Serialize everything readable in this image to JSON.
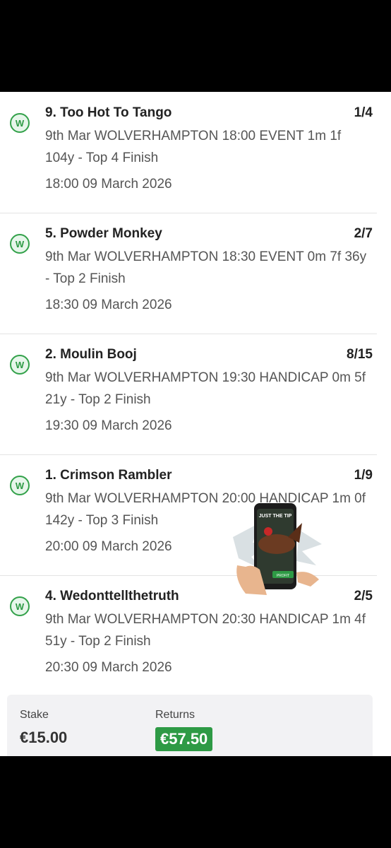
{
  "legs": [
    {
      "badge": "W",
      "selection": "9. Too Hot To Tango",
      "odds": "1/4",
      "description": "9th Mar WOLVERHAMPTON 18:00 EVENT 1m 1f 104y - Top 4 Finish",
      "time": "18:00 09 March 2026"
    },
    {
      "badge": "W",
      "selection": "5. Powder Monkey",
      "odds": "2/7",
      "description": "9th Mar WOLVERHAMPTON 18:30 EVENT 0m 7f 36y - Top 2 Finish",
      "time": "18:30 09 March 2026"
    },
    {
      "badge": "W",
      "selection": "2. Moulin Booj",
      "odds": "8/15",
      "description": "9th Mar WOLVERHAMPTON 19:30 HANDICAP 0m 5f 21y - Top 2 Finish",
      "time": "19:30 09 March 2026"
    },
    {
      "badge": "W",
      "selection": "1. Crimson Rambler",
      "odds": "1/9",
      "description": "9th Mar WOLVERHAMPTON 20:00 HANDICAP 1m 0f 142y - Top 3 Finish",
      "time": "20:00 09 March 2026"
    },
    {
      "badge": "W",
      "selection": "4. Wedonttellthetruth",
      "odds": "2/5",
      "description": "9th Mar WOLVERHAMPTON 20:30 HANDICAP 1m 4f 51y - Top 2 Finish",
      "time": "20:30 09 March 2026"
    }
  ],
  "summary": {
    "stake_label": "Stake",
    "stake_value": "€15.00",
    "returns_label": "Returns",
    "returns_value": "€57.50"
  },
  "promo": {
    "title": "JUST THE TIP",
    "button": "PROFIT"
  },
  "colors": {
    "win_green": "#2e9a45",
    "badge_bg": "#e6f6ea"
  }
}
